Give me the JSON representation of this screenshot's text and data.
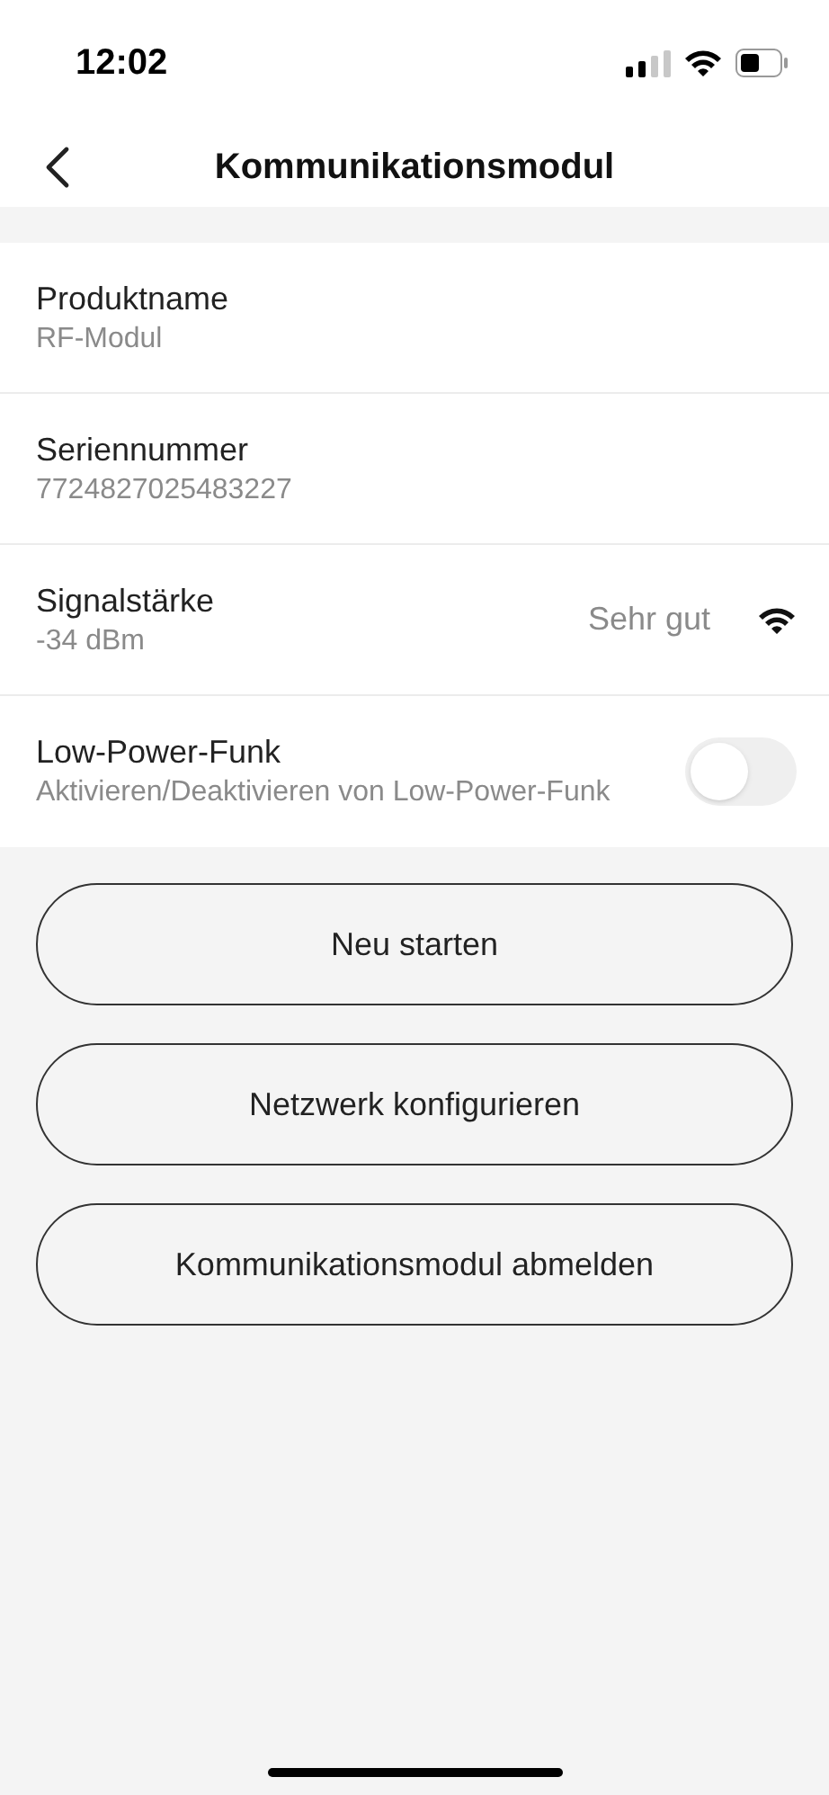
{
  "status_bar": {
    "time": "12:02"
  },
  "nav": {
    "title": "Kommunikationsmodul"
  },
  "rows": [
    {
      "kind": "info",
      "label": "Produktname",
      "value": "RF-Modul"
    },
    {
      "kind": "info",
      "label": "Seriennummer",
      "value": "7724827025483227"
    },
    {
      "kind": "signal",
      "label": "Signalstärke",
      "value": "-34 dBm",
      "reading": "Sehr gut"
    },
    {
      "kind": "toggle",
      "label": "Low-Power-Funk",
      "value": "Aktivieren/Deaktivieren von Low-Power-Funk",
      "on": false
    }
  ],
  "buttons": [
    "Neu starten",
    "Netzwerk konfigurieren",
    "Kommunikationsmodul abmelden"
  ]
}
